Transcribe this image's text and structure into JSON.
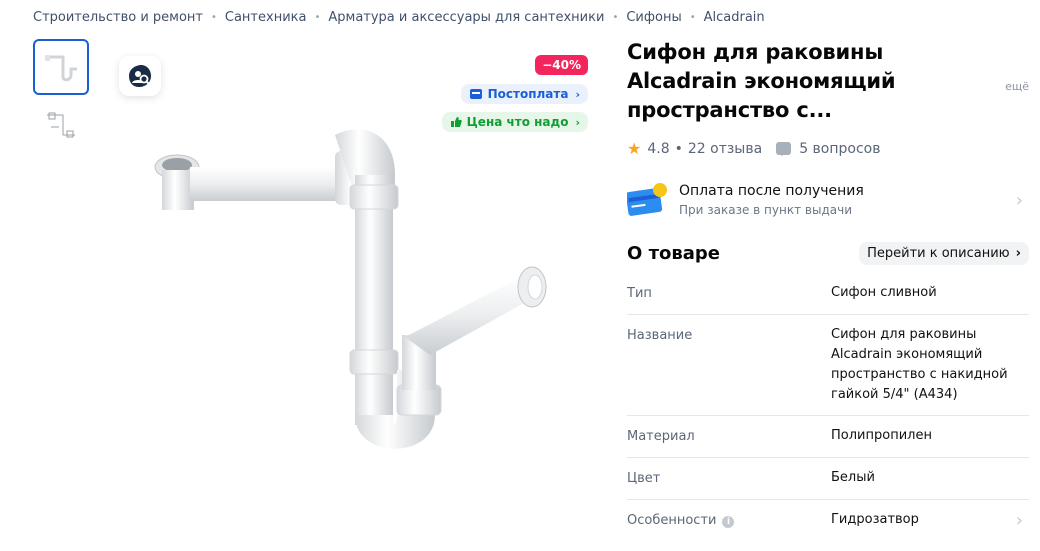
{
  "breadcrumbs": [
    "Строительство и ремонт",
    "Сантехника",
    "Арматура и аксессуары для сантехники",
    "Сифоны",
    "Alcadrain"
  ],
  "badges": {
    "discount": "−40%",
    "postpay": "Постоплата",
    "good_price": "Цена что надо"
  },
  "product": {
    "title": "Сифон для раковины Alcadrain экономящий пространство с...",
    "more": "ещё",
    "rating": "4.8",
    "reviews": "22 отзыва",
    "questions": "5 вопросов"
  },
  "payment": {
    "title": "Оплата после получения",
    "subtitle": "При заказе в пункт выдачи"
  },
  "about": {
    "title": "О товаре",
    "goto": "Перейти к описанию"
  },
  "specs": [
    {
      "key": "Тип",
      "value": "Сифон сливной"
    },
    {
      "key": "Название",
      "value": "Сифон для раковины Alcadrain экономящий пространство с накидной гайкой 5/4\" (A434)"
    },
    {
      "key": "Материал",
      "value": "Полипропилен"
    },
    {
      "key": "Цвет",
      "value": "Белый"
    },
    {
      "key": "Особенности",
      "value": "Гидрозатвор"
    }
  ],
  "colors": {
    "accent": "#1a5fd6",
    "discount": "#f2255c",
    "good_price": "#129e31",
    "rating_star": "#f5a623"
  },
  "icons": [
    "zoom-search-icon",
    "postpay-icon",
    "thumb-up-icon",
    "star-icon",
    "question-icon",
    "card-icon",
    "chevron-right-icon",
    "info-icon"
  ]
}
